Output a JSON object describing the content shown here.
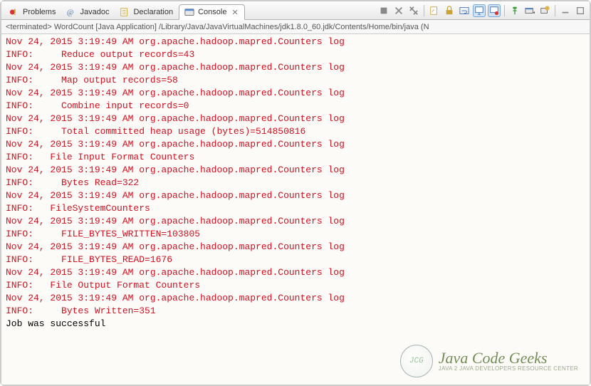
{
  "tabs": {
    "problems": "Problems",
    "javadoc": "Javadoc",
    "declaration": "Declaration",
    "console": "Console"
  },
  "status": "<terminated> WordCount [Java Application] /Library/Java/JavaVirtualMachines/jdk1.8.0_60.jdk/Contents/Home/bin/java (N",
  "watermark": {
    "brand": "Java Code Geeks",
    "tagline": "JAVA 2 JAVA DEVELOPERS RESOURCE CENTER",
    "logo": "JCG"
  },
  "console_lines": [
    {
      "cls": "err",
      "text": "Nov 24, 2015 3:19:49 AM org.apache.hadoop.mapred.Counters log"
    },
    {
      "cls": "err",
      "text": "INFO:     Reduce output records=43"
    },
    {
      "cls": "err",
      "text": "Nov 24, 2015 3:19:49 AM org.apache.hadoop.mapred.Counters log"
    },
    {
      "cls": "err",
      "text": "INFO:     Map output records=58"
    },
    {
      "cls": "err",
      "text": "Nov 24, 2015 3:19:49 AM org.apache.hadoop.mapred.Counters log"
    },
    {
      "cls": "err",
      "text": "INFO:     Combine input records=0"
    },
    {
      "cls": "err",
      "text": "Nov 24, 2015 3:19:49 AM org.apache.hadoop.mapred.Counters log"
    },
    {
      "cls": "err",
      "text": "INFO:     Total committed heap usage (bytes)=514850816"
    },
    {
      "cls": "err",
      "text": "Nov 24, 2015 3:19:49 AM org.apache.hadoop.mapred.Counters log"
    },
    {
      "cls": "err",
      "text": "INFO:   File Input Format Counters "
    },
    {
      "cls": "err",
      "text": "Nov 24, 2015 3:19:49 AM org.apache.hadoop.mapred.Counters log"
    },
    {
      "cls": "err",
      "text": "INFO:     Bytes Read=322"
    },
    {
      "cls": "err",
      "text": "Nov 24, 2015 3:19:49 AM org.apache.hadoop.mapred.Counters log"
    },
    {
      "cls": "err",
      "text": "INFO:   FileSystemCounters"
    },
    {
      "cls": "err",
      "text": "Nov 24, 2015 3:19:49 AM org.apache.hadoop.mapred.Counters log"
    },
    {
      "cls": "err",
      "text": "INFO:     FILE_BYTES_WRITTEN=103805"
    },
    {
      "cls": "err",
      "text": "Nov 24, 2015 3:19:49 AM org.apache.hadoop.mapred.Counters log"
    },
    {
      "cls": "err",
      "text": "INFO:     FILE_BYTES_READ=1676"
    },
    {
      "cls": "err",
      "text": "Nov 24, 2015 3:19:49 AM org.apache.hadoop.mapred.Counters log"
    },
    {
      "cls": "err",
      "text": "INFO:   File Output Format Counters "
    },
    {
      "cls": "err",
      "text": "Nov 24, 2015 3:19:49 AM org.apache.hadoop.mapred.Counters log"
    },
    {
      "cls": "err",
      "text": "INFO:     Bytes Written=351"
    },
    {
      "cls": "out",
      "text": "Job was successful"
    }
  ]
}
